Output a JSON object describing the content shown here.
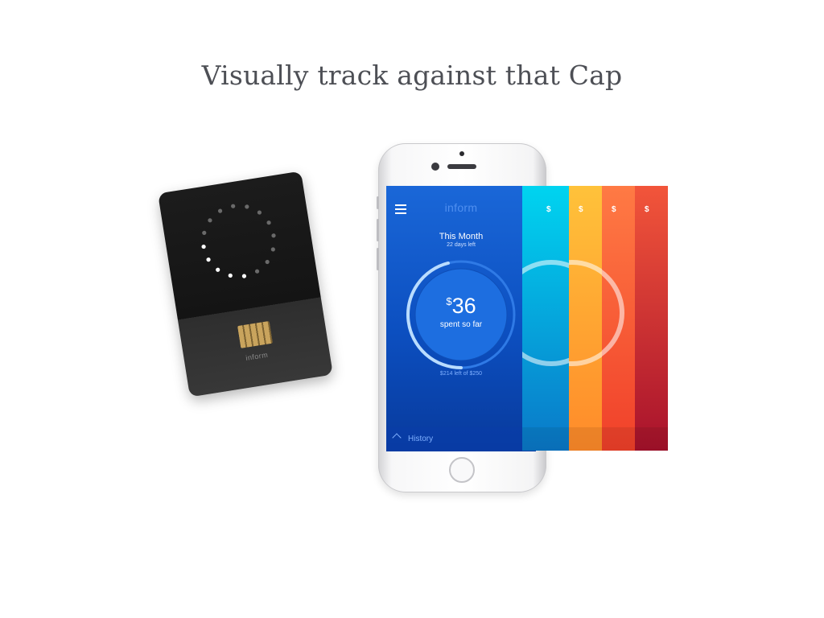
{
  "headline": "Visually track against that Cap",
  "card": {
    "brand": "inform",
    "ring_total_dots": 16,
    "ring_lit_dots": 5,
    "chip_icon": "chip-icon"
  },
  "app": {
    "logo": "inform",
    "menu_icon": "hamburger-menu-icon",
    "card_icon_label": "$",
    "period": "This Month",
    "days_left": "22 days left",
    "currency": "$",
    "amount": "36",
    "spent_label": "spent so far",
    "remaining": "$214 left of $250",
    "progress": 0.144,
    "history_label": "History"
  },
  "screens": [
    {
      "color_top": "#00d4f0",
      "color_bottom": "#0a78c8",
      "icon_label": "$"
    },
    {
      "color_top": "#ffc23a",
      "color_bottom": "#ff8a2a",
      "icon_label": "$"
    },
    {
      "color_top": "#ff7a44",
      "color_bottom": "#f0402a",
      "icon_label": "$"
    },
    {
      "color_top": "#f2553a",
      "color_bottom": "#a8122c",
      "icon_label": "$"
    }
  ]
}
